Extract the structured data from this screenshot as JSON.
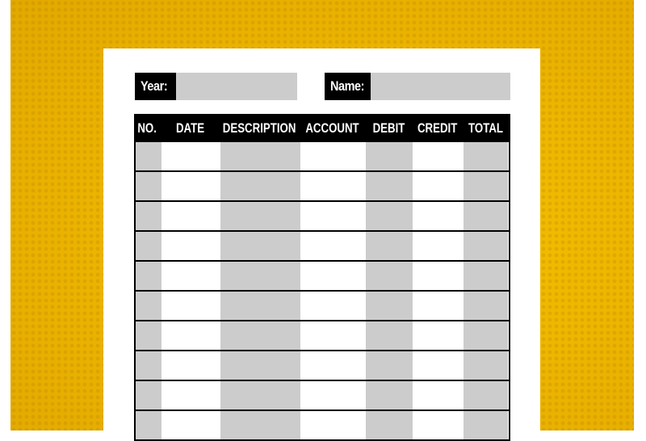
{
  "form": {
    "year_label": "Year:",
    "year_value": "",
    "name_label": "Name:",
    "name_value": ""
  },
  "table": {
    "headers": [
      "NO.",
      "DATE",
      "DESCRIPTION",
      "ACCOUNT",
      "DEBIT",
      "CREDIT",
      "TOTAL"
    ],
    "visible_empty_rows": 10
  },
  "colors": {
    "background": "#eeb400",
    "header": "#000000",
    "shaded_column": "#cccccc",
    "paper": "#ffffff"
  }
}
